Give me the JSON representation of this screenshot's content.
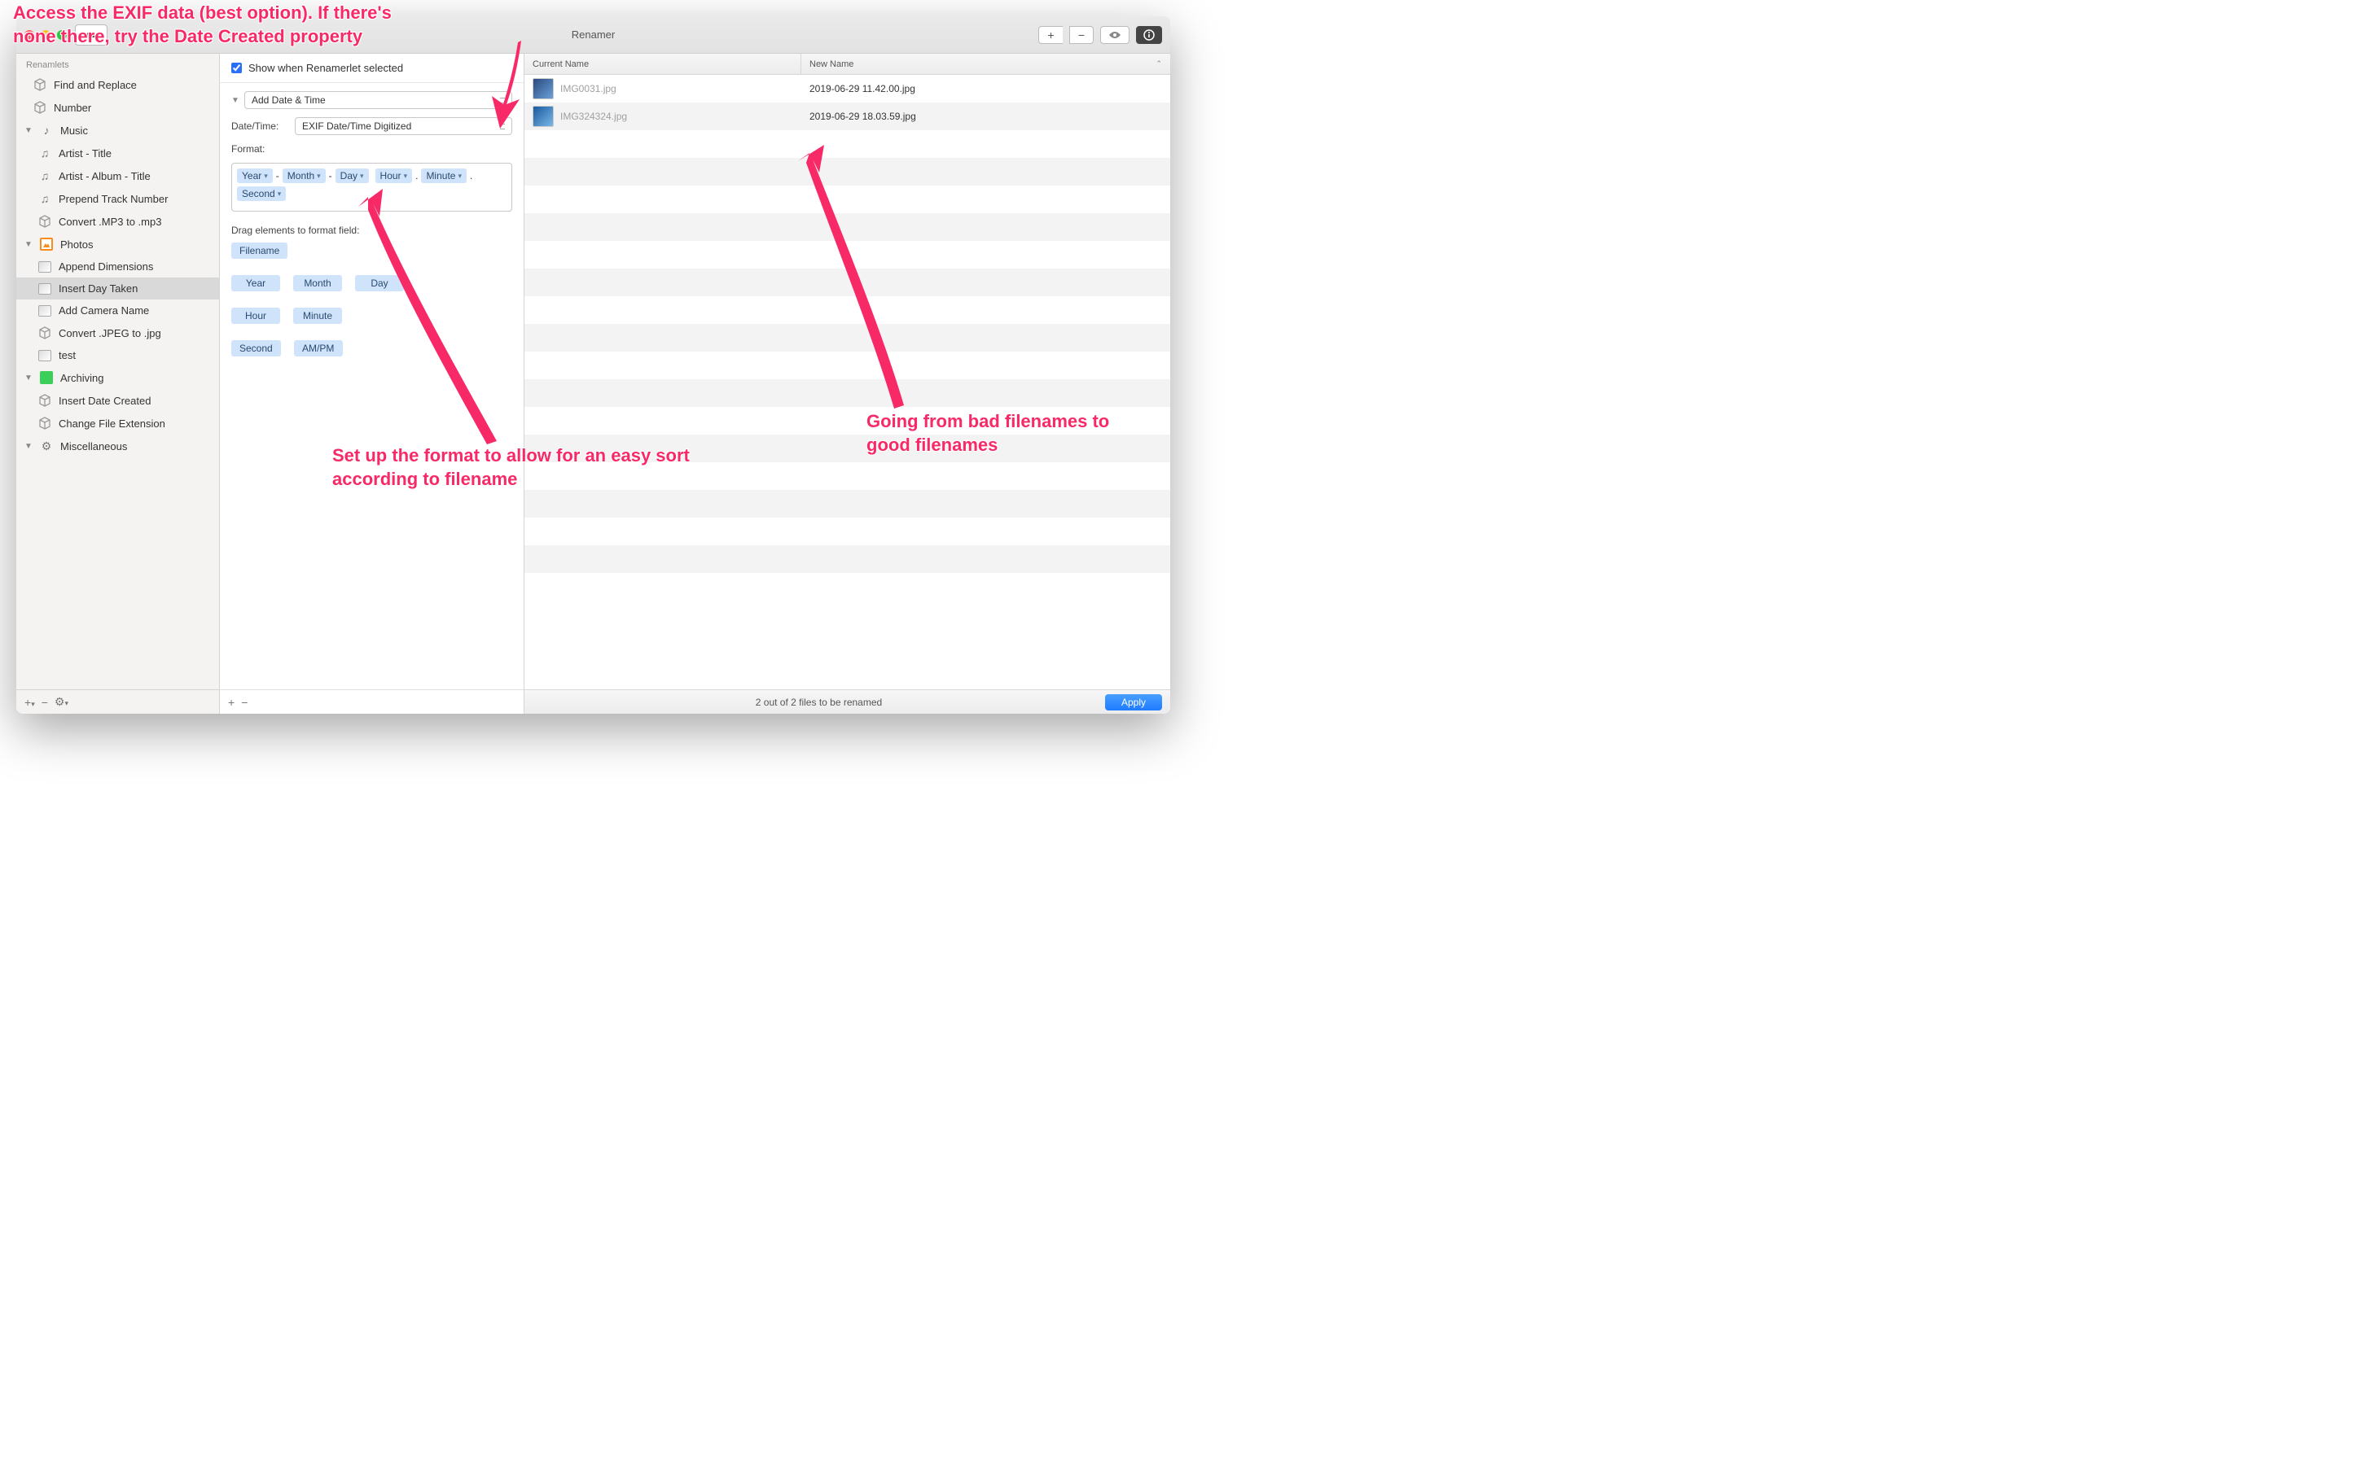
{
  "window": {
    "title": "Renamer"
  },
  "sidebar": {
    "header": "Renamlets",
    "top": [
      {
        "label": "Find and Replace"
      },
      {
        "label": "Number"
      }
    ],
    "groups": [
      {
        "name": "Music",
        "items": [
          {
            "label": "Artist - Title"
          },
          {
            "label": "Artist - Album - Title"
          },
          {
            "label": "Prepend Track Number"
          },
          {
            "label": "Convert .MP3 to .mp3"
          }
        ]
      },
      {
        "name": "Photos",
        "items": [
          {
            "label": "Append Dimensions"
          },
          {
            "label": "Insert Day Taken",
            "selected": true
          },
          {
            "label": "Add Camera Name"
          },
          {
            "label": "Convert .JPEG to .jpg"
          },
          {
            "label": "test"
          }
        ]
      },
      {
        "name": "Archiving",
        "items": [
          {
            "label": "Insert Date Created"
          },
          {
            "label": "Change File Extension"
          }
        ]
      },
      {
        "name": "Miscellaneous",
        "items": []
      }
    ]
  },
  "config": {
    "show_when_selected": "Show when Renamerlet selected",
    "renamelet_type": "Add Date & Time",
    "datetime_label": "Date/Time:",
    "datetime_value": "EXIF Date/Time Digitized",
    "format_label": "Format:",
    "format_tokens": [
      "Year",
      "Month",
      "Day",
      "Hour",
      "Minute",
      "Second"
    ],
    "format_separators": [
      "-",
      "-",
      "",
      ".",
      "."
    ],
    "drag_hint": "Drag elements to format field:",
    "palette": [
      "Filename",
      "Year",
      "Month",
      "Day",
      "Hour",
      "Minute",
      "Second",
      "AM/PM"
    ]
  },
  "files": {
    "columns": {
      "current": "Current Name",
      "new": "New Name"
    },
    "rows": [
      {
        "current": "IMG0031.jpg",
        "new": "2019-06-29 11.42.00.jpg"
      },
      {
        "current": "IMG324324.jpg",
        "new": "2019-06-29 18.03.59.jpg"
      }
    ],
    "status": "2 out of 2 files to be renamed",
    "apply": "Apply"
  },
  "annotations": {
    "a1": "Access the EXIF data (best option). If there's none there, try the Date Created property",
    "a2": "Set up the format to allow for an easy sort according to filename",
    "a3": "Going from bad filenames to good filenames"
  }
}
